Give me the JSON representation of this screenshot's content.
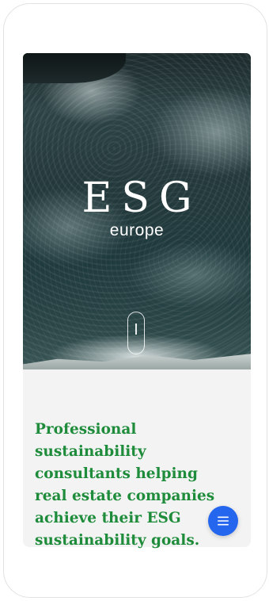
{
  "hero": {
    "logo_main": "ESG",
    "logo_sub": "europe",
    "background_icon": "ocean-aerial-image",
    "scroll_icon": "scroll-down-indicator-icon"
  },
  "intro": {
    "text": "Professional sustainability consultants helping real estate companies achieve their ESG sustainability goals.",
    "color": "#1e8c3a"
  },
  "menu_button": {
    "icon": "menu-icon",
    "color": "#2566ef"
  }
}
